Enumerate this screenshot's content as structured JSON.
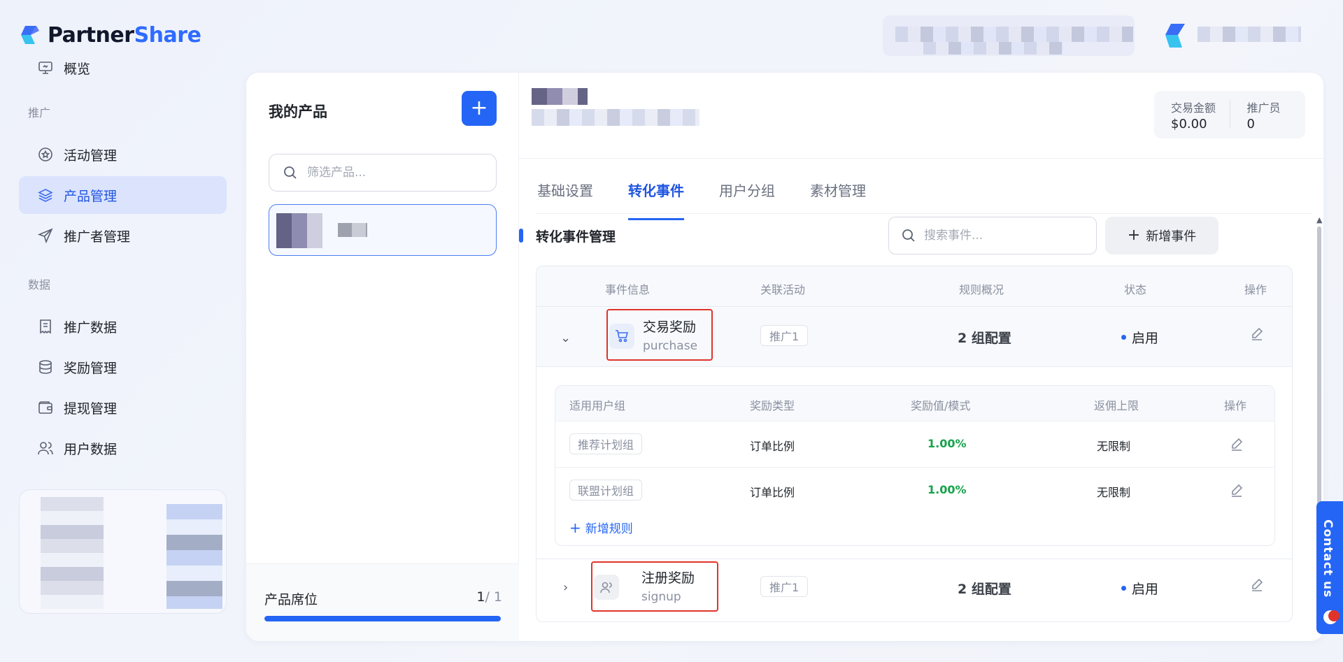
{
  "brand": {
    "name_part1": "Partner",
    "name_part2": "Share"
  },
  "sidebar": {
    "overview": "概览",
    "section_promo": "推广",
    "promo_items": [
      "活动管理",
      "产品管理",
      "推广者管理"
    ],
    "section_data": "数据",
    "data_items": [
      "推广数据",
      "奖励管理",
      "提现管理",
      "用户数据"
    ],
    "active_item": "产品管理"
  },
  "products": {
    "title": "我的产品",
    "add_label": "+",
    "search_placeholder": "筛选产品...",
    "footer_label": "产品席位",
    "seats_used": "1",
    "seats_total": "/ 1",
    "seats_fraction": 1.0
  },
  "stats": {
    "amount_label": "交易金额",
    "amount_value": "$0.00",
    "promoter_label": "推广员",
    "promoter_value": "0"
  },
  "tabs": [
    "基础设置",
    "转化事件",
    "用户分组",
    "素材管理"
  ],
  "active_tab": "转化事件",
  "events": {
    "section_title": "转化事件管理",
    "search_placeholder": "搜索事件...",
    "add_label": "新增事件",
    "columns": [
      "事件信息",
      "关联活动",
      "规则概况",
      "状态",
      "操作"
    ],
    "rows": [
      {
        "name": "交易奖励",
        "code": "purchase",
        "activity": "推广1",
        "rules": "2 组配置",
        "status": "启用",
        "expanded": true,
        "icon": "cart-icon"
      },
      {
        "name": "注册奖励",
        "code": "signup",
        "activity": "推广1",
        "rules": "2 组配置",
        "status": "启用",
        "expanded": false,
        "icon": "user-icon"
      }
    ],
    "sub_columns": [
      "适用用户组",
      "奖励类型",
      "奖励值/模式",
      "返佣上限",
      "操作"
    ],
    "sub_rows": [
      {
        "group": "推荐计划组",
        "type": "订单比例",
        "value": "1.00%",
        "limit": "无限制"
      },
      {
        "group": "联盟计划组",
        "type": "订单比例",
        "value": "1.00%",
        "limit": "无限制"
      }
    ],
    "add_rule_label": "新增规则"
  },
  "contact": {
    "label": "Contact us"
  },
  "colors": {
    "accent": "#2565f5",
    "active_bg": "#dbe3fd",
    "success": "#16a34a",
    "highlight": "#e0342b"
  }
}
